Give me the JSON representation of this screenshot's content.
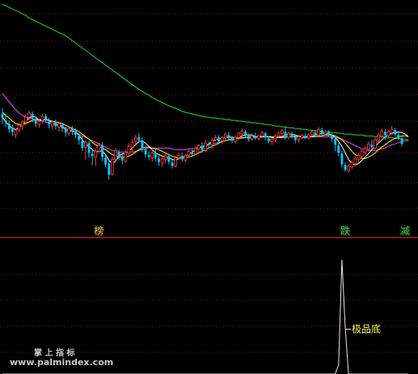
{
  "chart_data": {
    "type": "candlestick",
    "colors": {
      "up": "#ff3c3c",
      "down": "#00c8ff",
      "ma_short": "#ffffff",
      "ma_mid": "#ffff00",
      "ma_long": "#ff44ff",
      "ma_longest": "#22dd22",
      "divider": "#ff3333",
      "grid": "#8a1010",
      "indicator": "#e6e6e6",
      "label_bang": "#ffc040",
      "label_die": "#33dd33",
      "label_jian": "#33dd33",
      "label_jipindi": "#ffff55"
    },
    "price_ylim": [
      0,
      290
    ],
    "indicator_ylim": [
      0,
      160
    ],
    "candles": [
      [
        150,
        145,
        157,
        138
      ],
      [
        142,
        140,
        150,
        134
      ],
      [
        138,
        131,
        142,
        127
      ],
      [
        133,
        128,
        137,
        123
      ],
      [
        125,
        130,
        132,
        120
      ],
      [
        131,
        136,
        139,
        127
      ],
      [
        135,
        140,
        142,
        130
      ],
      [
        140,
        146,
        149,
        136
      ],
      [
        146,
        151,
        154,
        142
      ],
      [
        150,
        145,
        153,
        140
      ],
      [
        143,
        138,
        147,
        134
      ],
      [
        137,
        141,
        143,
        133
      ],
      [
        142,
        147,
        150,
        138
      ],
      [
        147,
        143,
        150,
        139
      ],
      [
        141,
        137,
        145,
        132
      ],
      [
        135,
        140,
        142,
        130
      ],
      [
        140,
        135,
        143,
        131
      ],
      [
        134,
        138,
        140,
        128
      ],
      [
        137,
        132,
        139,
        128
      ],
      [
        131,
        127,
        134,
        122
      ],
      [
        126,
        132,
        135,
        123
      ],
      [
        132,
        129,
        135,
        124
      ],
      [
        129,
        124,
        132,
        120
      ],
      [
        123,
        118,
        126,
        112
      ],
      [
        117,
        108,
        123,
        104
      ],
      [
        109,
        115,
        118,
        94
      ],
      [
        114,
        102,
        117,
        96
      ],
      [
        101,
        98,
        105,
        87
      ],
      [
        97,
        104,
        108,
        86
      ],
      [
        104,
        111,
        115,
        101
      ],
      [
        111,
        97,
        115,
        92
      ],
      [
        96,
        88,
        99,
        84
      ],
      [
        89,
        75,
        95,
        69
      ],
      [
        76,
        94,
        97,
        74
      ],
      [
        94,
        105,
        108,
        90
      ],
      [
        103,
        97,
        106,
        93
      ],
      [
        96,
        93,
        100,
        88
      ],
      [
        92,
        103,
        106,
        90
      ],
      [
        102,
        110,
        114,
        98
      ],
      [
        109,
        115,
        119,
        104
      ],
      [
        116,
        121,
        124,
        112
      ],
      [
        121,
        118,
        126,
        114
      ],
      [
        117,
        107,
        121,
        103
      ],
      [
        106,
        100,
        110,
        96
      ],
      [
        99,
        97,
        104,
        93
      ],
      [
        96,
        102,
        106,
        91
      ],
      [
        102,
        96,
        106,
        92
      ],
      [
        95,
        91,
        99,
        86
      ],
      [
        90,
        95,
        98,
        85
      ],
      [
        94,
        99,
        101,
        89
      ],
      [
        98,
        91,
        101,
        88
      ],
      [
        90,
        86,
        94,
        83
      ],
      [
        86,
        96,
        98,
        84
      ],
      [
        96,
        99,
        102,
        93
      ],
      [
        98,
        94,
        102,
        91
      ],
      [
        93,
        99,
        101,
        90
      ],
      [
        99,
        104,
        106,
        96
      ],
      [
        103,
        101,
        106,
        97
      ],
      [
        101,
        108,
        110,
        99
      ],
      [
        107,
        111,
        113,
        102
      ],
      [
        111,
        105,
        115,
        102
      ],
      [
        105,
        114,
        118,
        103
      ],
      [
        113,
        112,
        116,
        108
      ],
      [
        112,
        118,
        120,
        107
      ],
      [
        118,
        121,
        124,
        116
      ],
      [
        121,
        116,
        124,
        112
      ],
      [
        117,
        121,
        123,
        113
      ],
      [
        120,
        125,
        127,
        117
      ],
      [
        124,
        120,
        128,
        118
      ],
      [
        120,
        117,
        123,
        114
      ],
      [
        116,
        121,
        124,
        113
      ],
      [
        121,
        126,
        128,
        118
      ],
      [
        125,
        129,
        132,
        121
      ],
      [
        128,
        124,
        130,
        120
      ],
      [
        123,
        119,
        126,
        116
      ],
      [
        119,
        123,
        126,
        117
      ],
      [
        123,
        120,
        127,
        118
      ],
      [
        120,
        123,
        125,
        117
      ],
      [
        123,
        127,
        129,
        120
      ],
      [
        126,
        121,
        128,
        117
      ],
      [
        120,
        116,
        122,
        114
      ],
      [
        116,
        119,
        121,
        112
      ],
      [
        118,
        123,
        125,
        115
      ],
      [
        123,
        126,
        128,
        120
      ],
      [
        126,
        129,
        132,
        123
      ],
      [
        128,
        121,
        134,
        118
      ],
      [
        121,
        126,
        128,
        118
      ],
      [
        125,
        122,
        128,
        120
      ],
      [
        122,
        118,
        124,
        114
      ],
      [
        118,
        122,
        124,
        115
      ],
      [
        121,
        124,
        125,
        119
      ],
      [
        123,
        120,
        126,
        119
      ],
      [
        120,
        124,
        126,
        118
      ],
      [
        124,
        128,
        130,
        122
      ],
      [
        127,
        124,
        130,
        122
      ],
      [
        124,
        131,
        134,
        122
      ],
      [
        130,
        125,
        133,
        122
      ],
      [
        125,
        128,
        130,
        123
      ],
      [
        128,
        124,
        130,
        122
      ],
      [
        123,
        119,
        126,
        116
      ],
      [
        119,
        112,
        122,
        104
      ],
      [
        111,
        102,
        114,
        98
      ],
      [
        101,
        88,
        104,
        84
      ],
      [
        87,
        81,
        90,
        79
      ],
      [
        80,
        86,
        88,
        78
      ],
      [
        85,
        90,
        93,
        82
      ],
      [
        89,
        95,
        98,
        86
      ],
      [
        94,
        99,
        102,
        90
      ],
      [
        98,
        104,
        106,
        95
      ],
      [
        103,
        108,
        111,
        100
      ],
      [
        107,
        113,
        116,
        104
      ],
      [
        112,
        109,
        118,
        106
      ],
      [
        108,
        118,
        121,
        106
      ],
      [
        117,
        124,
        127,
        114
      ],
      [
        123,
        129,
        132,
        121
      ],
      [
        128,
        124,
        131,
        118
      ],
      [
        123,
        128,
        130,
        120
      ],
      [
        127,
        131,
        135,
        124
      ],
      [
        130,
        125,
        133,
        122
      ],
      [
        124,
        120,
        127,
        118
      ],
      [
        120,
        113,
        122,
        110
      ]
    ],
    "ma_short": [
      146,
      140,
      136,
      132,
      131,
      133,
      137,
      141,
      145,
      147,
      146,
      142,
      142,
      143,
      142,
      139,
      137,
      136,
      134,
      131,
      129,
      129,
      127,
      124,
      118,
      113,
      110,
      106,
      103,
      104,
      104,
      100,
      93,
      89,
      92,
      98,
      101,
      101,
      104,
      108,
      112,
      116,
      117,
      114,
      110,
      106,
      102,
      100,
      98,
      97,
      96,
      94,
      93,
      95,
      97,
      98,
      100,
      103,
      106,
      108,
      109,
      110,
      113,
      116,
      118,
      119,
      120,
      121,
      122,
      121,
      121,
      121,
      123,
      124,
      124,
      124,
      122,
      122,
      122,
      122,
      122,
      121,
      120,
      121,
      122,
      124,
      125,
      125,
      124,
      122,
      121,
      121,
      122,
      122,
      124,
      125,
      126,
      126,
      125,
      124,
      121,
      116,
      110,
      102,
      94,
      89,
      87,
      89,
      93,
      97,
      101,
      106,
      110,
      114,
      118,
      122,
      124,
      126,
      127,
      128,
      127,
      125,
      122
    ],
    "ma_mid": [
      152,
      148,
      145,
      141,
      138,
      137,
      137,
      138,
      140,
      142,
      143,
      143,
      143,
      143,
      142,
      141,
      140,
      139,
      138,
      136,
      134,
      132,
      130,
      128,
      125,
      122,
      119,
      115,
      112,
      110,
      108,
      106,
      103,
      100,
      98,
      97,
      97,
      97,
      98,
      100,
      103,
      106,
      108,
      109,
      109,
      108,
      107,
      106,
      104,
      102,
      100,
      98,
      97,
      96,
      96,
      96,
      97,
      98,
      100,
      102,
      104,
      106,
      108,
      110,
      112,
      114,
      116,
      117,
      118,
      119,
      119,
      120,
      121,
      121,
      122,
      122,
      122,
      122,
      122,
      122,
      122,
      122,
      121,
      121,
      121,
      121,
      122,
      122,
      123,
      123,
      122,
      122,
      122,
      122,
      122,
      123,
      123,
      124,
      124,
      124,
      123,
      121,
      118,
      114,
      109,
      104,
      100,
      97,
      95,
      95,
      97,
      99,
      102,
      106,
      109,
      112,
      115,
      118,
      120,
      122,
      123,
      123,
      122
    ],
    "ma_long": [
      175,
      170,
      165,
      160,
      155,
      151,
      148,
      146,
      145,
      144,
      143,
      142,
      141,
      140,
      139,
      138,
      137,
      136,
      134,
      133,
      131,
      129,
      127,
      125,
      123,
      121,
      119,
      117,
      115,
      113,
      111,
      109,
      107,
      105,
      104,
      103,
      103,
      103,
      103,
      103,
      104,
      105,
      106,
      107,
      108,
      108,
      108,
      108,
      108,
      108,
      108,
      107,
      106,
      106,
      106,
      106,
      107,
      107,
      108,
      109,
      110,
      111,
      112,
      113,
      114,
      115,
      116,
      117,
      118,
      118,
      119,
      120,
      120,
      121,
      121,
      121,
      121,
      122,
      122,
      122,
      122,
      122,
      122,
      122,
      122,
      122,
      122,
      122,
      122,
      122,
      122,
      122,
      122,
      122,
      122,
      122,
      122,
      122,
      122,
      122,
      121,
      120,
      119,
      117,
      115,
      113,
      111,
      109,
      107,
      106,
      105,
      105,
      105,
      106,
      107,
      108,
      110,
      112,
      113,
      115,
      116,
      117,
      117
    ],
    "ma_longest": [
      285,
      283,
      281,
      279,
      277,
      275,
      273,
      271,
      268,
      266,
      264,
      262,
      260,
      258,
      256,
      254,
      252,
      250,
      248,
      246,
      243,
      240,
      237,
      234,
      231,
      228,
      225,
      222,
      219,
      216,
      213,
      210,
      207,
      204,
      201,
      198,
      195,
      192,
      189,
      186,
      183,
      180,
      178,
      175,
      173,
      170,
      168,
      166,
      164,
      162,
      160,
      158,
      157,
      155,
      153,
      152,
      151,
      150,
      149,
      148,
      147,
      146,
      146,
      145,
      145,
      144,
      144,
      143,
      143,
      142,
      142,
      141,
      141,
      140,
      140,
      139,
      139,
      138,
      138,
      137,
      137,
      136,
      135,
      135,
      134,
      134,
      133,
      133,
      132,
      132,
      131,
      131,
      130,
      130,
      129,
      129,
      128,
      128,
      128,
      127,
      127,
      126,
      126,
      125,
      125,
      125,
      124,
      124,
      124,
      123,
      123,
      123,
      122,
      122,
      122,
      121,
      121,
      121,
      120,
      120,
      119,
      119,
      118
    ],
    "indicator": [
      0,
      0,
      0,
      0,
      0,
      0,
      0,
      0,
      0,
      0,
      0,
      0,
      0,
      0,
      0,
      0,
      0,
      0,
      0,
      0,
      0,
      0,
      0,
      0,
      0,
      0,
      0,
      0,
      0,
      0,
      0,
      0,
      0,
      0,
      0,
      0,
      0,
      0,
      0,
      0,
      0,
      0,
      0,
      0,
      0,
      0,
      0,
      0,
      0,
      0,
      0,
      0,
      0,
      0,
      0,
      0,
      0,
      0,
      0,
      0,
      0,
      0,
      0,
      0,
      0,
      0,
      0,
      0,
      0,
      0,
      0,
      0,
      0,
      0,
      0,
      0,
      0,
      0,
      0,
      0,
      0,
      0,
      0,
      0,
      0,
      0,
      0,
      0,
      0,
      0,
      0,
      0,
      0,
      0,
      0,
      0,
      0,
      0,
      0,
      0,
      0,
      12,
      148,
      60,
      0,
      0,
      0,
      0,
      0,
      0,
      0,
      0,
      0,
      0,
      0,
      0,
      0,
      0,
      0,
      0,
      0,
      0,
      0
    ],
    "labels": [
      {
        "text": "榜",
        "index": 29,
        "color_key": "label_bang"
      },
      {
        "text": "跌",
        "index": 103,
        "color_key": "label_die"
      },
      {
        "text": "减",
        "index": 121,
        "color_key": "label_jian"
      }
    ],
    "indicator_label": {
      "text": "极品底",
      "index": 103,
      "value": 58
    }
  },
  "watermark": {
    "line1": "掌 上 指 标",
    "line2": "www.palmindex.com"
  }
}
